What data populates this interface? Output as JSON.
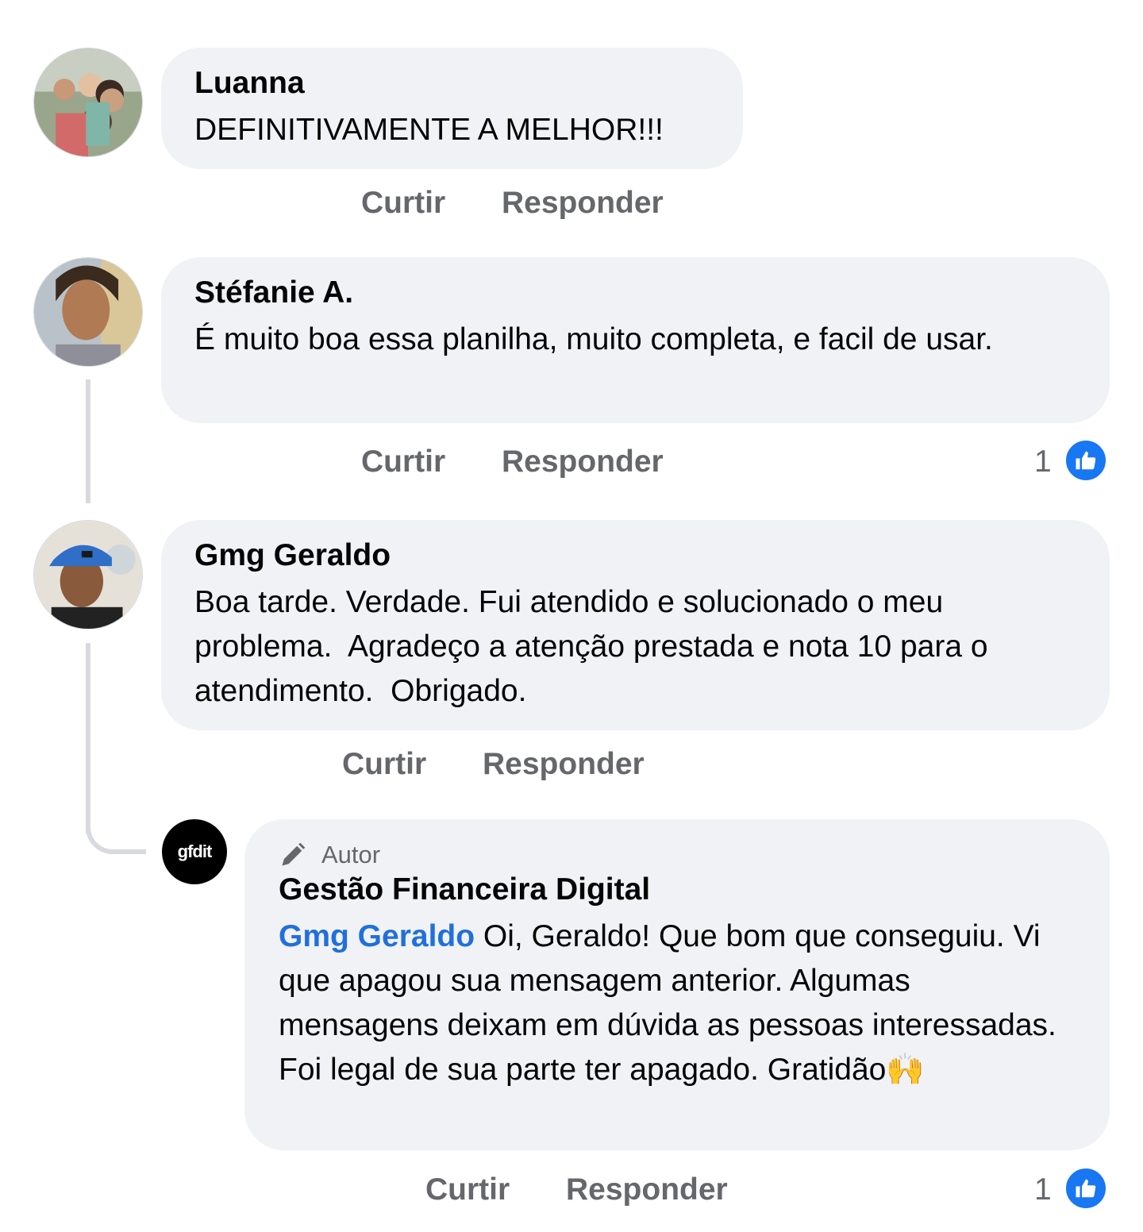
{
  "actions": {
    "like": "Curtir",
    "reply": "Responder"
  },
  "comments": [
    {
      "author": "Luanna",
      "text": "DEFINITIVAMENTE A MELHOR!!!"
    },
    {
      "author": "Stéfanie A.",
      "text": "É muito boa essa planilha, muito completa, e facil de usar.",
      "likes": "1"
    },
    {
      "author": "Gmg Geraldo",
      "text": "Boa tarde. Verdade. Fui atendido e solucionado o meu problema.  Agradeço a atenção prestada e nota 10 para o atendimento.  Obrigado."
    }
  ],
  "reply": {
    "badge": "Autor",
    "author": "Gestão Financeira Digital",
    "logo_text": "gfdit",
    "mention": "Gmg Geraldo",
    "text": " Oi, Geraldo! Que bom que conseguiu. Vi que apagou sua mensagem anterior. Algumas mensagens deixam em dúvida as pessoas interessadas. Foi legal de sua parte ter apagado. Gratidão🙌",
    "likes": "1"
  },
  "colors": {
    "accent": "#1877f2",
    "bubble": "#f0f2f5",
    "muted": "#65676b",
    "mention": "#216fdb"
  },
  "icons": [
    "thumbs-up-icon",
    "pencil-icon"
  ]
}
